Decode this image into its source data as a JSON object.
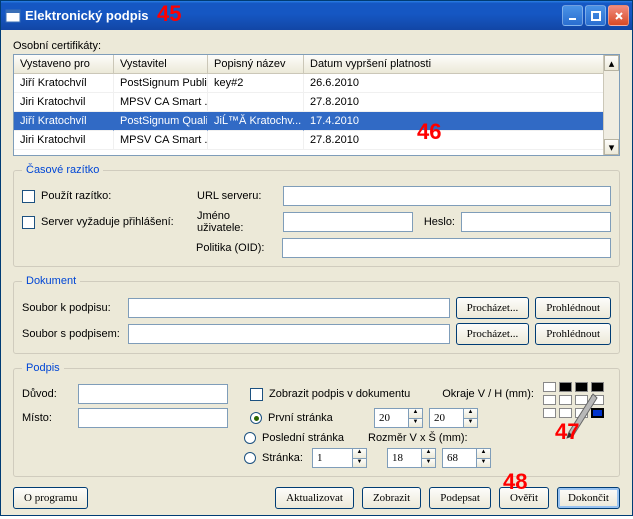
{
  "window": {
    "title": "Elektronický podpis"
  },
  "certificates": {
    "section_label": "Osobní certifikáty:",
    "columns": [
      "Vystaveno pro",
      "Vystavitel",
      "Popisný název",
      "Datum vypršení platnosti"
    ],
    "rows": [
      {
        "c0": "Jiří Kratochvíl",
        "c1": "PostSignum Publi...",
        "c2": "key#2",
        "c3": "26.6.2010"
      },
      {
        "c0": "Jiri Kratochvil",
        "c1": "MPSV CA Smart ...",
        "c2": "",
        "c3": "27.8.2010"
      },
      {
        "c0": "Jiří Kratochvíl",
        "c1": "PostSignum Quali...",
        "c2": "JiĹ™Ă­ Kratochv...",
        "c3": "17.4.2010"
      },
      {
        "c0": "Jiri Kratochvil",
        "c1": "MPSV CA Smart ...",
        "c2": "",
        "c3": "27.8.2010"
      }
    ],
    "selected_index": 2
  },
  "timestamp": {
    "legend": "Časové razítko",
    "use_stamp": "Použít razítko:",
    "requires_login": "Server vyžaduje přihlášení:",
    "url_label": "URL serveru:",
    "user_label": "Jméno uživatele:",
    "pass_label": "Heslo:",
    "policy_label": "Politika (OID):"
  },
  "document": {
    "legend": "Dokument",
    "file_to_sign": "Soubor k podpisu:",
    "file_with_sig": "Soubor s podpisem:",
    "browse": "Procházet...",
    "view": "Prohlédnout"
  },
  "signature": {
    "legend": "Podpis",
    "reason": "Důvod:",
    "place": "Místo:",
    "show_in_doc": "Zobrazit podpis v dokumentu",
    "first_page": "První stránka",
    "last_page": "Poslední stránka",
    "page": "Stránka:",
    "margin_label": "Okraje V / H (mm):",
    "size_label": "Rozměr V x Š (mm):",
    "margin_v": "20",
    "margin_h": "20",
    "size_v": "18",
    "size_s": "68",
    "page_num": "1"
  },
  "buttons": {
    "about": "O programu",
    "update": "Aktualizovat",
    "show": "Zobrazit",
    "sign": "Podepsat",
    "verify": "Ověřit",
    "finish": "Dokončit"
  },
  "annotations": {
    "a45": "45",
    "a46": "46",
    "a47": "47",
    "a48": "48"
  },
  "swatch_colors": [
    "#ffffff",
    "#000000",
    "#000000",
    "#000000",
    "#ffffff",
    "#ffffff",
    "#ffffff",
    "#ffffff",
    "#ffffff",
    "#ffffff",
    "#ffffff",
    "#0033cc"
  ]
}
